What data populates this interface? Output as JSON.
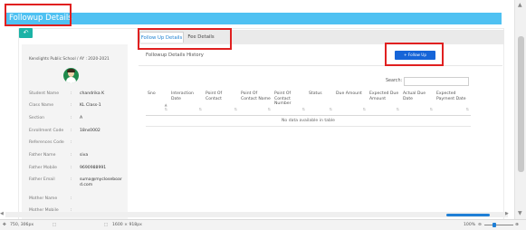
{
  "page": {
    "title": "Followup Details",
    "back_icon": "undo-arrow-icon"
  },
  "student": {
    "school": "Kenslights Public School / AY : 2020-2021",
    "fields": [
      {
        "label": "Student Name",
        "value": "chandrika K"
      },
      {
        "label": "Class Name",
        "value": "KL Class-1"
      },
      {
        "label": "Section",
        "value": "A"
      },
      {
        "label": "Enrollment Code",
        "value": "18ns0002"
      },
      {
        "label": "References Code",
        "value": ""
      },
      {
        "label": "Father Name",
        "value": "siva"
      },
      {
        "label": "Father Mobile",
        "value": "9690988991"
      },
      {
        "label": "Father Email",
        "value": "suma@mycloseboard.com"
      },
      {
        "label": "Mother Name",
        "value": ""
      },
      {
        "label": "Mother Mobile",
        "value": ""
      }
    ]
  },
  "tabs": [
    {
      "label": "Follow Up Details",
      "active": true
    },
    {
      "label": "Fee Details",
      "active": false
    }
  ],
  "section": {
    "title": "Followup Details History",
    "add_button": "+ Follow Up"
  },
  "search": {
    "label": "Search:",
    "value": ""
  },
  "table": {
    "columns": [
      "Sno",
      "Interaction Date",
      "Point Of Contact",
      "Point Of Contact Name",
      "Point Of Contact Number",
      "Status",
      "Due Amount",
      "Expected Due Amount",
      "Actual Due Date",
      "Expected Payment Date"
    ],
    "empty_message": "No data available in table"
  },
  "statusbar": {
    "coords": "750, 306px",
    "selection": "1600 × 918px",
    "zoom": "100%"
  },
  "colors": {
    "header": "#4fc1f2",
    "accent": "#1665d8",
    "highlight": "#e02020"
  }
}
